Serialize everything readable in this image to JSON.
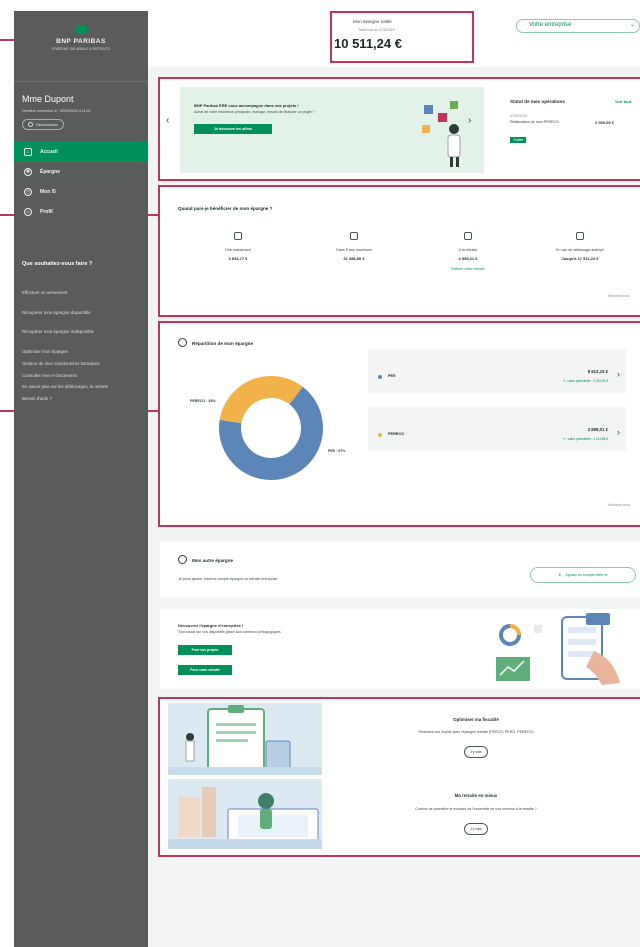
{
  "sidebar": {
    "brand": "BNP PARIBAS",
    "brand_sub": "EPARGNE SALARIALE & RETRAITE",
    "user_name": "Mme Dupont",
    "user_sub": "Dernière connexion le : 00/00/0000 à 11:00",
    "logout_label": "Déconnexion",
    "nav": [
      {
        "label": "Accueil",
        "icon": "home-icon"
      },
      {
        "label": "Épargne",
        "icon": "gear-icon"
      },
      {
        "label": "Mon /5",
        "icon": "clock-icon"
      },
      {
        "label": "Profil",
        "icon": "user-icon"
      }
    ],
    "help_title": "Que souhaitez-vous faire ?",
    "help_links": [
      "Effectuer un versement",
      "Récupérer mon épargne disponible",
      "Récupérer mon épargne indisponible",
      "Optimiser mon épargne",
      "Gestion de mes coordonnées bancaires",
      "Consulter mes e-documents",
      "En savoir plus sur les déblocages, la retraite",
      "Besoin d'aide ?"
    ]
  },
  "header": {
    "total_title": "Mon épargne totale",
    "total_date": "Total brut au 27/8/2023",
    "total_amount": "10 511,24 €",
    "company_select": "Votre entreprise"
  },
  "banner": {
    "title": "BNP Paribas ERE vous accompagne dans vos projets !",
    "subtitle": "Achat de votre résidence principale, mariage, besoin de financer un projet ?",
    "button": "Je découvre les offres"
  },
  "suivi": {
    "title": "Statut de mes opérations",
    "link": "Voir tout",
    "date": "07/07/2023",
    "description": "Réallocation de mon PERECO",
    "amount": "2 000,00 €",
    "badge": "Traitée"
  },
  "availability": {
    "title": "Quand puis-je bénéficier de mon épargne ?",
    "columns": [
      {
        "label": "Dès maintenant",
        "value": "3 653,77 €",
        "link": ""
      },
      {
        "label": "Dans 5 ans maximum",
        "value": "31 988,56 €",
        "link": ""
      },
      {
        "label": "A la retraite",
        "value": "4 598,01 €",
        "link": "Estimer votre retraite"
      },
      {
        "label": "En cas de déblocage anticipé",
        "value": "Jusqu'à 17 511,24 €",
        "link": ""
      }
    ],
    "footnote": "Montants bruts"
  },
  "repartition": {
    "title": "Répartition de mon épargne",
    "label_pereco": "PERECO : 33%",
    "label_pee": "PEE : 67%",
    "projects_head": "Pour vos projets",
    "projects_name": "PEE",
    "projects_amount": "5 913,23 €",
    "projects_gain": "+/- value potentielle : 3 162,49 €",
    "retirement_head": "Pour préparer ma retraite",
    "retirement_name": "PERECO",
    "retirement_amount": "2 598,01 €",
    "retirement_gain": "+/- value potentielle : 1 114,86 €",
    "footnote": "Montants bruts"
  },
  "chart_data": {
    "type": "pie",
    "categories": [
      "PERECO",
      "PEE"
    ],
    "values": [
      33,
      67
    ],
    "colors": [
      "#f2b24a",
      "#5c86b8"
    ]
  },
  "other_savings": {
    "title": "Mon autre épargne",
    "subtitle": "Je peux ajouter d'autres compte épargne ou retraite entreprise",
    "button": "Ajouter un compte externe"
  },
  "discover": {
    "title": "Découvrez l'épargne d'entreprise !",
    "subtitle": "Tout savoir sur vos dispositifs grâce aux contenus pédagogiques",
    "button_projects": "Pour vos projets",
    "button_retirement": "Pour votre retraite"
  },
  "tiles": [
    {
      "title": "Optimiser ma fiscalité",
      "subtitle": "Réduisez vos impôts avec l'épargne retraite (PERCO, PERO, PERECO)",
      "button": "J'y vais"
    },
    {
      "title": "Ma retraite en mieux",
      "subtitle": "Curieux de connaître le montant de l'ensemble de vos revenus à la retraite ?",
      "button": "J'y vais"
    }
  ],
  "colors": {
    "brand_green": "#00915a",
    "sidebar_bg": "#5a5c5b",
    "highlight": "#c2335e",
    "pie_pee": "#5c86b8",
    "pie_pereco": "#f2b24a"
  }
}
